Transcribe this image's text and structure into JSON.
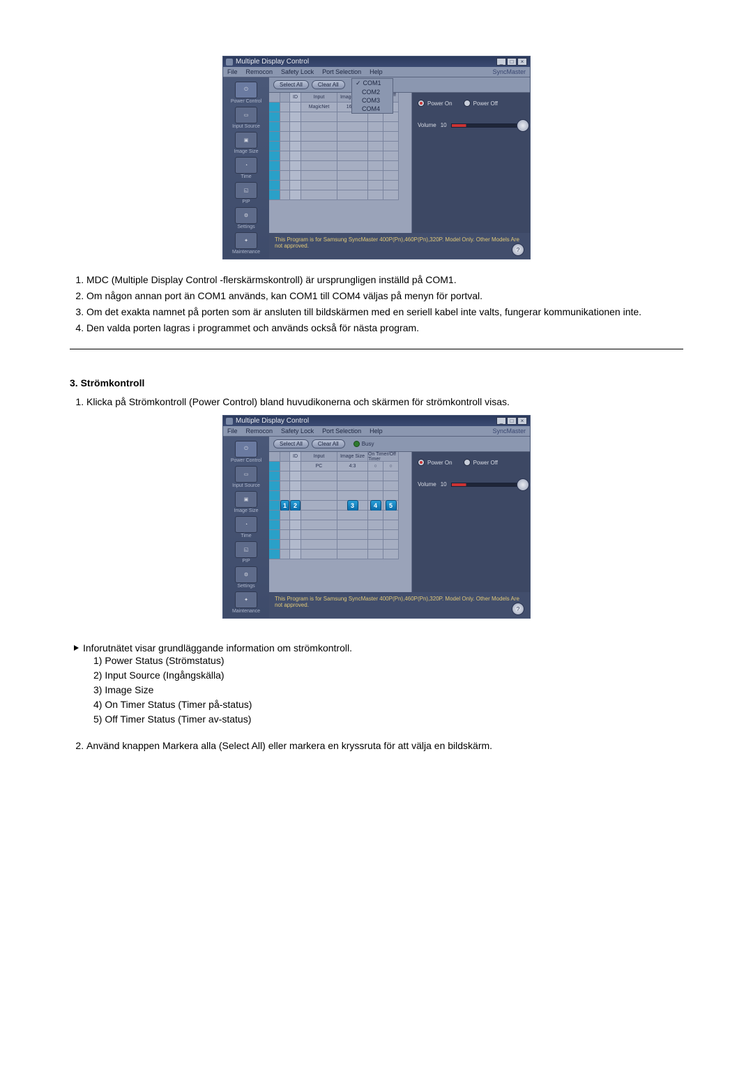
{
  "app": {
    "title": "Multiple Display Control",
    "menus": {
      "file": "File",
      "remocon": "Remocon",
      "safety_lock": "Safety Lock",
      "port_selection": "Port Selection",
      "help": "Help",
      "brand": "SyncMaster"
    },
    "port_dropdown": [
      "COM1",
      "COM2",
      "COM3",
      "COM4"
    ],
    "sidebar": {
      "power_control": "Power Control",
      "input_source": "Input Source",
      "image_size": "Image Size",
      "time": "Time",
      "pip": "PIP",
      "settings": "Settings",
      "maintenance": "Maintenance"
    },
    "toolbar": {
      "select_all": "Select All",
      "clear_all": "Clear All",
      "busy": "Busy"
    },
    "grid": {
      "headers": {
        "chk": "",
        "pwr": "",
        "id": "ID",
        "input": "Input",
        "size": "Image Size",
        "timer": "On Timer/Off Timer"
      },
      "row0": {
        "input_pc": "PC",
        "input_mv": "MagicNet",
        "size_43": "4:3",
        "size_169": "16 : 9"
      }
    },
    "panel": {
      "power_on": "Power On",
      "power_off": "Power Off",
      "volume_label": "Volume",
      "volume_value": "10"
    },
    "statusbar": "This Program is for Samsung SyncMaster 400P(Pn),460P(Pn),320P. Model Only. Other Models Are not approved.",
    "badges": [
      "1",
      "2",
      "3",
      "4",
      "5"
    ]
  },
  "doc": {
    "list1": {
      "i1": "MDC (Multiple Display Control -flerskärmskontroll) är ursprungligen inställd på COM1.",
      "i2": "Om någon annan port än COM1 används, kan COM1 till COM4 väljas på menyn för portval.",
      "i3": "Om det exakta namnet på porten som är ansluten till bildskärmen med en seriell kabel inte valts, fungerar kommunikationen inte.",
      "i4": "Den valda porten lagras i programmet och används också för nästa program."
    },
    "section_title": "3. Strömkontroll",
    "list2": {
      "i1": "Klicka på Strömkontroll (Power Control) bland huvudikonerna och skärmen för strömkontroll visas."
    },
    "bullet_intro": "Inforutnätet visar grundläggande information om strömkontroll.",
    "sublist": {
      "l1": "1) Power Status (Strömstatus)",
      "l2": "2) Input Source (Ingångskälla)",
      "l3": "3) Image Size",
      "l4": "4) On Timer Status (Timer på-status)",
      "l5": "5) Off Timer Status (Timer av-status)"
    },
    "list3": {
      "i2": "Använd knappen Markera alla (Select All) eller markera en kryssruta för att välja en bildskärm."
    }
  }
}
